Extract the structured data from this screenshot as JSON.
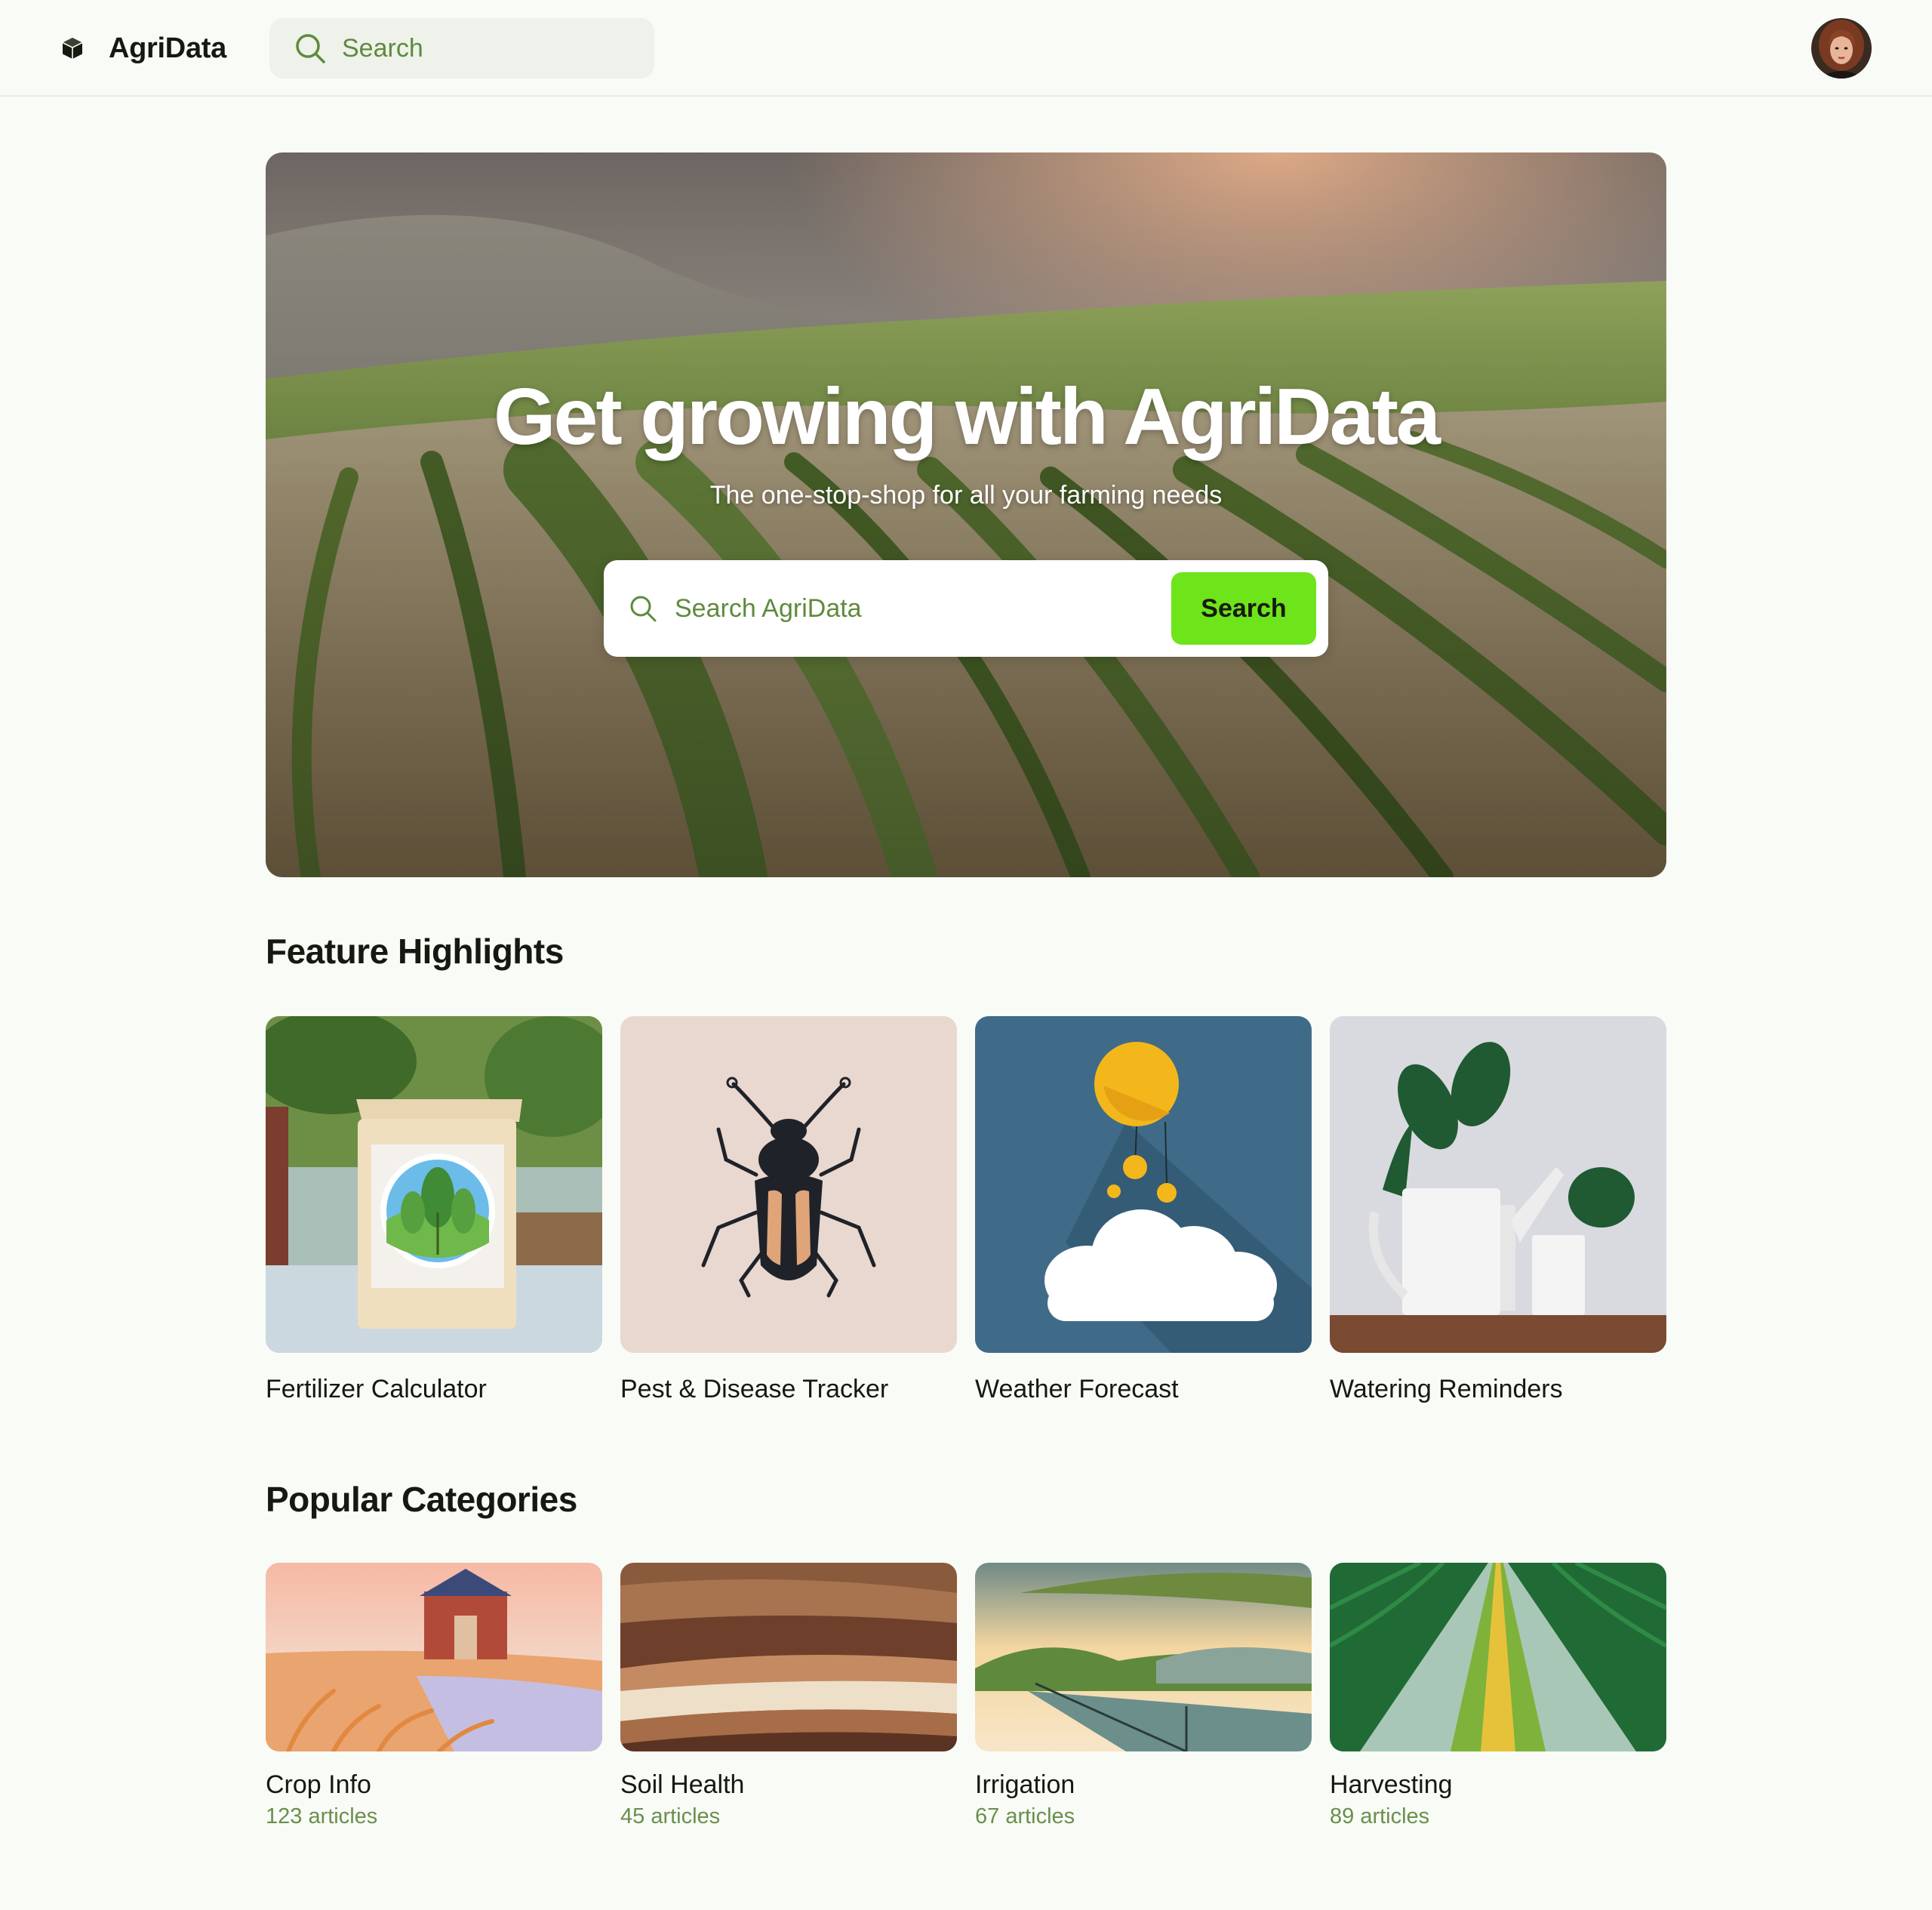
{
  "app": {
    "name": "AgriData",
    "search_placeholder": "Search"
  },
  "hero": {
    "title": "Get growing with AgriData",
    "subtitle": "The one-stop-shop for all your farming needs",
    "search_placeholder": "Search AgriData",
    "search_button": "Search"
  },
  "features": {
    "title": "Feature Highlights",
    "items": [
      {
        "label": "Fertilizer Calculator"
      },
      {
        "label": "Pest & Disease Tracker"
      },
      {
        "label": "Weather Forecast"
      },
      {
        "label": "Watering Reminders"
      }
    ]
  },
  "categories": {
    "title": "Popular Categories",
    "items": [
      {
        "label": "Crop Info",
        "count": "123 articles"
      },
      {
        "label": "Soil Health",
        "count": "45 articles"
      },
      {
        "label": "Irrigation",
        "count": "67 articles"
      },
      {
        "label": "Harvesting",
        "count": "89 articles"
      }
    ]
  },
  "colors": {
    "accent": "#6ee41b",
    "background": "#f9fbf7",
    "muted_green": "#6a8f4c",
    "text": "#141a0f"
  },
  "icons": [
    "cube-logo-icon",
    "search-icon",
    "avatar"
  ]
}
